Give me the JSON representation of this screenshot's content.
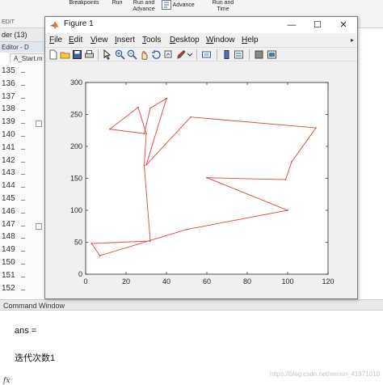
{
  "toolstrip": {
    "breakpoints_label": "Breakpoints",
    "run_label": "Run",
    "run_advance_label": "Run and Advance",
    "advance_label": "Advance",
    "run_time_label": "Run and Time",
    "edit_section_label": "EDIT"
  },
  "left_panel": {
    "folder_label": "der (13)",
    "editor_title": "Editor - D",
    "editor_tab": "A_Start.m",
    "line_numbers": [
      "135",
      "136",
      "137",
      "138",
      "139",
      "140",
      "141",
      "142",
      "143",
      "144",
      "145",
      "146",
      "147",
      "148",
      "149",
      "150",
      "151",
      "152"
    ]
  },
  "figure": {
    "title": "Figure 1",
    "window_buttons": {
      "minimize": "—",
      "maximize": "☐",
      "close": "✕"
    },
    "menu": [
      {
        "first": "F",
        "rest": "ile"
      },
      {
        "first": "E",
        "rest": "dit"
      },
      {
        "first": "V",
        "rest": "iew"
      },
      {
        "first": "I",
        "rest": "nsert"
      },
      {
        "first": "T",
        "rest": "ools"
      },
      {
        "first": "D",
        "rest": "esktop"
      },
      {
        "first": "W",
        "rest": "indow"
      },
      {
        "first": "H",
        "rest": "elp"
      }
    ],
    "menu_overflow": "▸"
  },
  "command_window": {
    "title": "Command Window",
    "line1": "ans =",
    "line2": "迭代次数1",
    "prompt": "fx"
  },
  "watermark": "https://blog.csdn.net/weixin_41971010",
  "chart_data": {
    "type": "line",
    "title": "",
    "xlabel": "",
    "ylabel": "",
    "xlim": [
      0,
      120
    ],
    "ylim": [
      0,
      300
    ],
    "xticks": [
      0,
      20,
      40,
      60,
      80,
      100,
      120
    ],
    "yticks": [
      0,
      50,
      100,
      150,
      200,
      250,
      300
    ],
    "grid": false,
    "line_color": "#e8413a",
    "series": [
      {
        "x": [
          40,
          32,
          29,
          12,
          26,
          30,
          29,
          32,
          3,
          7,
          50,
          100,
          60,
          99,
          102,
          114,
          52,
          30,
          40
        ],
        "y": [
          275,
          260,
          220,
          227,
          261,
          220,
          170,
          52,
          48,
          29,
          70,
          100,
          151,
          148,
          176,
          229,
          246,
          171,
          275
        ]
      }
    ]
  }
}
